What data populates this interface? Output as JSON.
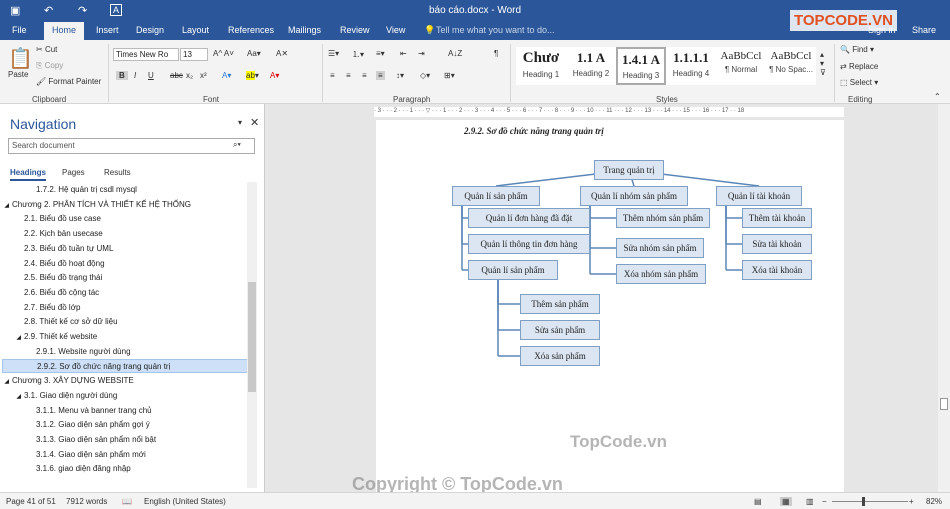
{
  "titlebar": {
    "title": "báo cáo.docx - Word",
    "quick_access": {
      "save": "save-icon",
      "undo": "↶",
      "redo": "↷",
      "format": "A"
    }
  },
  "tabs": [
    "File",
    "Home",
    "Insert",
    "Design",
    "Layout",
    "References",
    "Mailings",
    "Review",
    "View"
  ],
  "tell_me": "Tell me what you want to do...",
  "user": {
    "sign_in": "Sign in",
    "share": "Share"
  },
  "clipboard": {
    "paste": "Paste",
    "cut": "Cut",
    "copy": "Copy",
    "format_painter": "Format Painter",
    "label": "Clipboard"
  },
  "font": {
    "name": "Times New Ro",
    "size": "13",
    "label": "Font",
    "bold": "B",
    "italic": "I",
    "underline": "U",
    "strike": "abc",
    "sub": "x₂",
    "sup": "x²"
  },
  "paragraph": {
    "label": "Paragraph"
  },
  "styles": {
    "label": "Styles",
    "items": [
      {
        "preview": "Chươ",
        "name": "Heading 1"
      },
      {
        "preview": "1.1  A",
        "name": "Heading 2"
      },
      {
        "preview": "1.4.1  A",
        "name": "Heading 3"
      },
      {
        "preview": "1.1.1.1",
        "name": "Heading 4"
      },
      {
        "preview": "AaBbCcl",
        "name": "¶ Normal"
      },
      {
        "preview": "AaBbCcl",
        "name": "¶ No Spac..."
      }
    ]
  },
  "editing": {
    "label": "Editing",
    "find": "Find",
    "replace": "Replace",
    "select": "Select"
  },
  "navigation": {
    "title": "Navigation",
    "search_placeholder": "Search document",
    "tabs": [
      "Headings",
      "Pages",
      "Results"
    ],
    "headings": [
      {
        "text": "1.7.2. Hệ quản trị csdl mysql",
        "level": 3
      },
      {
        "text": "Chương 2. PHÂN TÍCH VÀ THIẾT KẾ HỆ THỐNG",
        "level": 1,
        "expanded": true
      },
      {
        "text": "2.1. Biểu đồ use case",
        "level": 2
      },
      {
        "text": "2.2. Kịch bản usecase",
        "level": 2
      },
      {
        "text": "2.3. Biểu đồ tuần tự UML",
        "level": 2
      },
      {
        "text": "2.4. Biểu đồ hoạt động",
        "level": 2
      },
      {
        "text": "2.5. Biểu đồ trạng thái",
        "level": 2
      },
      {
        "text": "2.6. Biểu đồ cộng tác",
        "level": 2
      },
      {
        "text": "2.7. Biểu đồ lớp",
        "level": 2
      },
      {
        "text": "2.8. Thiết kế cơ sở dữ liệu",
        "level": 2
      },
      {
        "text": "2.9. Thiết kế website",
        "level": 2,
        "expanded": true
      },
      {
        "text": "2.9.1. Website người dùng",
        "level": 3
      },
      {
        "text": "2.9.2. Sơ đồ chức năng trang quản trị",
        "level": 3,
        "selected": true
      },
      {
        "text": "Chương 3. XÂY DỰNG WEBSITE",
        "level": 1,
        "expanded": true
      },
      {
        "text": "3.1. Giao diện người dùng",
        "level": 2,
        "expanded": true
      },
      {
        "text": "3.1.1. Menu và banner trang chủ",
        "level": 3
      },
      {
        "text": "3.1.2. Giao diện sản phẩm gợi ý",
        "level": 3
      },
      {
        "text": "3.1.3. Giao diện sản phẩm nổi bật",
        "level": 3
      },
      {
        "text": "3.1.4. Giao diện sản phẩm mới",
        "level": 3
      },
      {
        "text": "3.1.6. giao diện đăng nhập",
        "level": 3
      }
    ]
  },
  "document": {
    "caption": "2.9.2. Sơ đồ chức năng trang quản trị",
    "diagram": {
      "root": "Trang quản trị",
      "branches": [
        {
          "label": "Quản lí sản phẩm",
          "children": [
            "Quản lí đơn hàng đã đặt",
            "Quản lí thông tin đơn hàng",
            "Quản lí sản phẩm"
          ],
          "grandchildren": [
            "Thêm sản phẩm",
            "Sửa sản phẩm",
            "Xóa sản phẩm"
          ]
        },
        {
          "label": "Quản lí nhóm sản phẩm",
          "children": [
            "Thêm nhóm sản phẩm",
            "Sửa nhóm sản phẩm",
            "Xóa nhóm sản phẩm"
          ]
        },
        {
          "label": "Quản lí tài khoản",
          "children": [
            "Thêm tài khoản",
            "Sửa tài khoản",
            "Xóa tài khoản"
          ]
        }
      ]
    }
  },
  "watermarks": {
    "logo": "TOPCODE.VN",
    "center": "TopCode.vn",
    "bottom": "Copyright © TopCode.vn"
  },
  "status": {
    "page": "Page 41 of 51",
    "words": "7912 words",
    "language": "English (United States)",
    "zoom": "82%"
  }
}
